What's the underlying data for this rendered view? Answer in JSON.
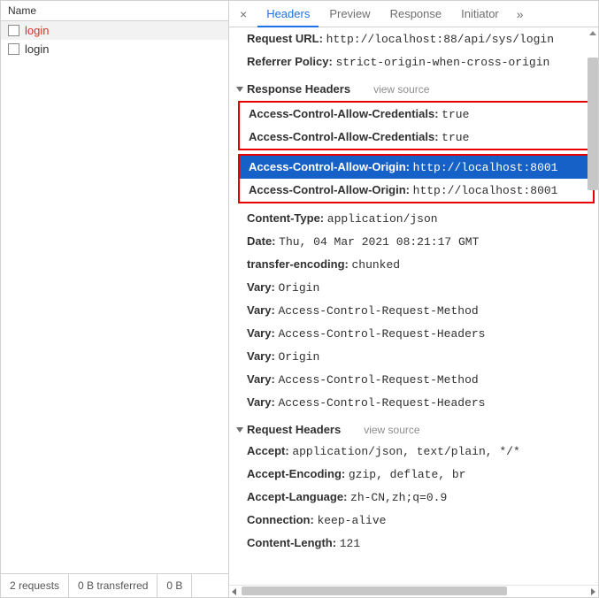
{
  "leftPane": {
    "columnHeader": "Name",
    "rows": [
      {
        "name": "login",
        "selected": true
      },
      {
        "name": "login",
        "selected": false
      }
    ],
    "status": {
      "requests": "2 requests",
      "transferred": "0 B transferred",
      "extra": "0 B"
    }
  },
  "tabs": {
    "close": "×",
    "items": [
      "Headers",
      "Preview",
      "Response",
      "Initiator"
    ],
    "active": 0,
    "overflow": "»"
  },
  "general": [
    {
      "k": "Request URL:",
      "v": "http://localhost:88/api/sys/login"
    },
    {
      "k": "Referrer Policy:",
      "v": "strict-origin-when-cross-origin"
    }
  ],
  "sections": {
    "responseHeaders": {
      "title": "Response Headers",
      "viewSource": "view source"
    },
    "requestHeaders": {
      "title": "Request Headers",
      "viewSource": "view source"
    }
  },
  "responseHeadersBox1": [
    {
      "k": "Access-Control-Allow-Credentials:",
      "v": "true"
    },
    {
      "k": "Access-Control-Allow-Credentials:",
      "v": "true"
    }
  ],
  "responseHeadersBox2": [
    {
      "k": "Access-Control-Allow-Origin:",
      "v": "http://localhost:8001",
      "selected": true
    },
    {
      "k": "Access-Control-Allow-Origin:",
      "v": "http://localhost:8001"
    }
  ],
  "responseHeadersRest": [
    {
      "k": "Content-Type:",
      "v": "application/json"
    },
    {
      "k": "Date:",
      "v": "Thu, 04 Mar 2021 08:21:17 GMT"
    },
    {
      "k": "transfer-encoding:",
      "v": "chunked"
    },
    {
      "k": "Vary:",
      "v": "Origin"
    },
    {
      "k": "Vary:",
      "v": "Access-Control-Request-Method"
    },
    {
      "k": "Vary:",
      "v": "Access-Control-Request-Headers"
    },
    {
      "k": "Vary:",
      "v": "Origin"
    },
    {
      "k": "Vary:",
      "v": "Access-Control-Request-Method"
    },
    {
      "k": "Vary:",
      "v": "Access-Control-Request-Headers"
    }
  ],
  "requestHeaders": [
    {
      "k": "Accept:",
      "v": "application/json, text/plain, */*"
    },
    {
      "k": "Accept-Encoding:",
      "v": "gzip, deflate, br"
    },
    {
      "k": "Accept-Language:",
      "v": "zh-CN,zh;q=0.9"
    },
    {
      "k": "Connection:",
      "v": "keep-alive"
    },
    {
      "k": "Content-Length:",
      "v": "121"
    }
  ]
}
